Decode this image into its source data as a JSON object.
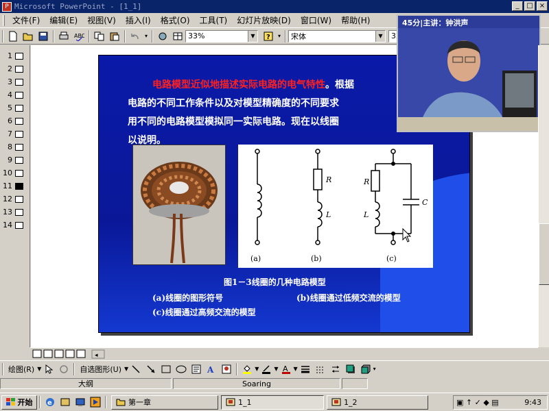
{
  "window": {
    "title": "Microsoft PowerPoint - [1_1]",
    "controls": [
      "_",
      "□",
      "×"
    ]
  },
  "menu": [
    "文件(F)",
    "编辑(E)",
    "视图(V)",
    "插入(I)",
    "格式(O)",
    "工具(T)",
    "幻灯片放映(D)",
    "窗口(W)",
    "帮助(H)"
  ],
  "toolbar": {
    "zoom": "33%",
    "font": "宋体",
    "font_size": "32+"
  },
  "outline": {
    "slides": [
      "1",
      "2",
      "3",
      "4",
      "5",
      "6",
      "7",
      "8",
      "9",
      "10",
      "11",
      "12",
      "13",
      "14"
    ],
    "active_index": 10
  },
  "slide": {
    "highlight": "电路模型近似地描述实际电路的电气特性",
    "text_after_highlight": "。根据",
    "line2": "电路的不同工作条件以及对模型精确度的不同要求",
    "line3": "用不同的电路模型模拟同一实际电路。现在以线圈",
    "line4": "以说明。",
    "figure_caption": "图1－3线圈的几种电路模型",
    "caption_a": "(a)线圈的图形符号",
    "caption_b": "(b)线圈通过低频交流的模型",
    "caption_c": "(c)线圈通过高频交流的模型",
    "diagram": {
      "labels": [
        "R",
        "L",
        "R",
        "L",
        "C"
      ],
      "sub_labels": [
        "(a)",
        "(b)",
        "(c)"
      ]
    }
  },
  "video": {
    "label": "45分|主讲：钟洪声"
  },
  "drawbar": {
    "draw": "绘图(R)",
    "autoshapes": "自选图形(U)"
  },
  "status": {
    "view": "大纲",
    "design": "Soaring"
  },
  "taskbar": {
    "start": "开始",
    "tasks": [
      "第一章",
      "1_1",
      "1_2"
    ],
    "clock": "9:43"
  },
  "colors": {
    "slide_bg": "#0a1aa8",
    "highlight": "#ff2020",
    "title_bar": "#0a246a"
  }
}
